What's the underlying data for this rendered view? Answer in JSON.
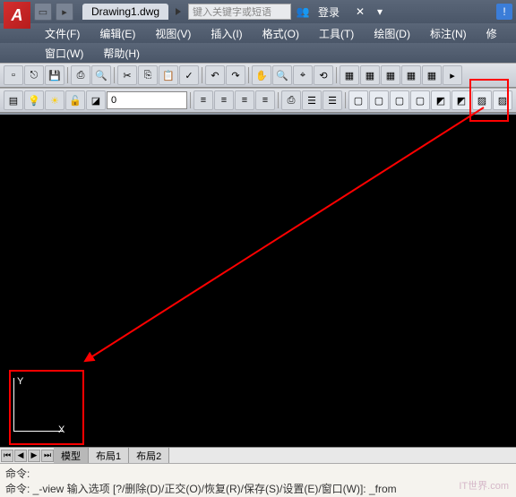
{
  "title": {
    "doc": "Drawing1.dwg"
  },
  "search": {
    "placeholder": "键入关键字或短语"
  },
  "login": {
    "label": "登录"
  },
  "menus": {
    "file": "文件(F)",
    "edit": "编辑(E)",
    "view": "视图(V)",
    "insert": "插入(I)",
    "format": "格式(O)",
    "tools": "工具(T)",
    "draw": "绘图(D)",
    "dim": "标注(N)",
    "mod": "修",
    "window": "窗口(W)",
    "help": "帮助(H)"
  },
  "layer": {
    "current": "0"
  },
  "ucs": {
    "x": "X",
    "y": "Y"
  },
  "tabs": {
    "model": "模型",
    "layout1": "布局1",
    "layout2": "布局2"
  },
  "cmd": {
    "line1": "命令:",
    "line2": "命令: _-view 输入选项 [?/删除(D)/正交(O)/恢复(R)/保存(S)/设置(E)/窗口(W)]: _from"
  },
  "watermark": "IT世界.com"
}
